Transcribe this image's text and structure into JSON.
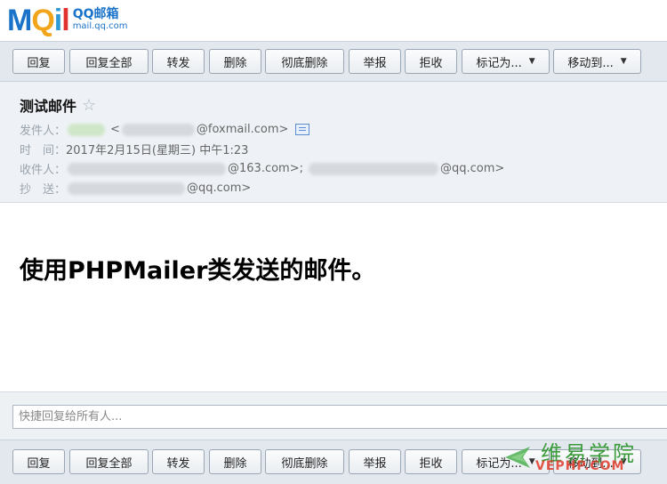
{
  "logo": {
    "word": "MQil",
    "brand_cn": "QQ邮箱",
    "domain": "mail.qq.com"
  },
  "toolbar": {
    "reply": "回复",
    "reply_all": "回复全部",
    "forward": "转发",
    "delete": "删除",
    "delete_perm": "彻底删除",
    "report": "举报",
    "reject": "拒收",
    "mark_as": "标记为...",
    "move_to": "移动到..."
  },
  "mail": {
    "subject": "测试邮件",
    "sender_label": "发件人：",
    "sender_lt": "<",
    "sender_domain": "@foxmail.com>",
    "time_label": "时　间：",
    "time_value": "2017年2月15日(星期三) 中午1:23",
    "to_label": "收件人：",
    "to_value1": "@163.com>;",
    "to_value2": "@qq.com>",
    "cc_label": "抄　送：",
    "cc_value": "@qq.com>",
    "body": "使用PHPMailer类发送的邮件。"
  },
  "reply": {
    "placeholder": "快捷回复给所有人..."
  },
  "watermark": {
    "cn": "维易学院",
    "en": "VEPHP.COM"
  },
  "colors": {
    "toolbar_bg": "#e3e8ee",
    "header_bg": "#eef2f6",
    "logo_blue": "#1a73c8"
  }
}
